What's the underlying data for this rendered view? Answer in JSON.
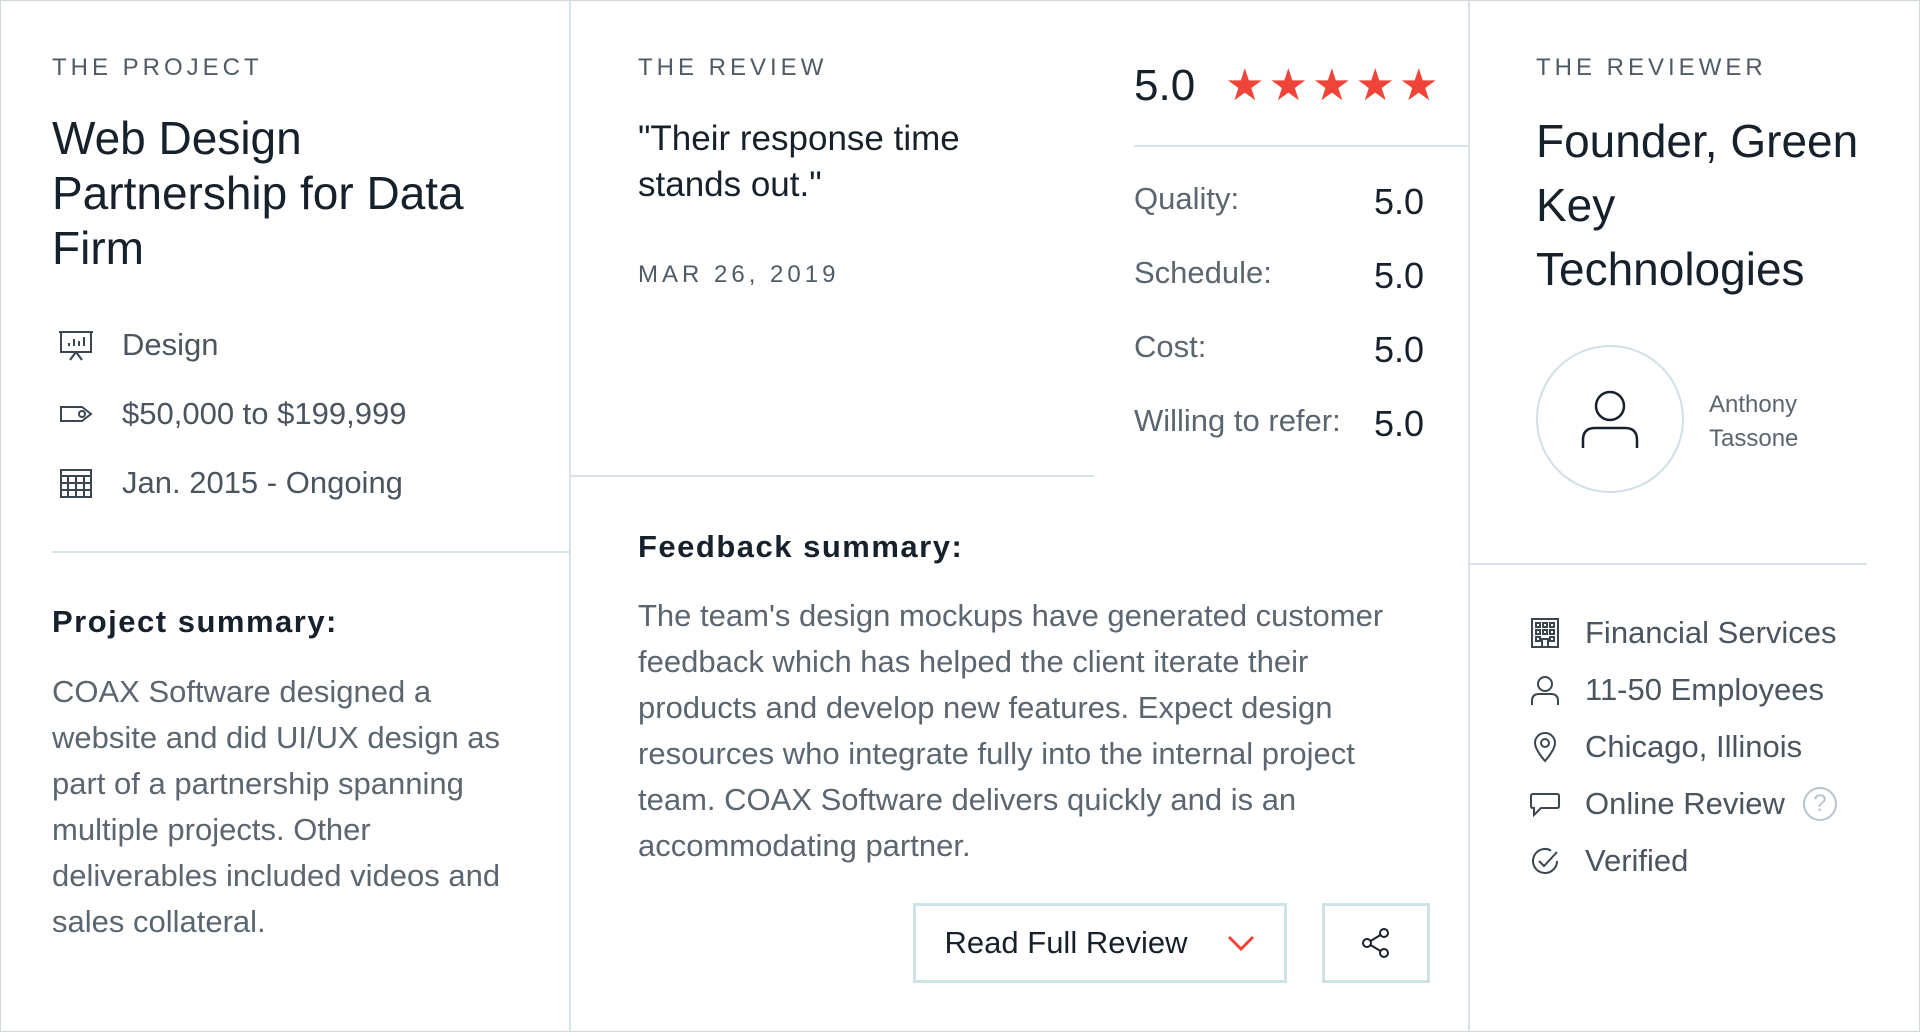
{
  "project": {
    "eyebrow": "THE PROJECT",
    "title": "Web Design Partnership for Data Firm",
    "service": "Design",
    "budget": "$50,000 to $199,999",
    "timeline": "Jan. 2015 - Ongoing",
    "summary_heading": "Project summary:",
    "summary_text": "COAX Software designed a website and did UI/UX design as part of a partnership spanning multiple projects. Other deliverables included videos and sales collateral."
  },
  "review": {
    "eyebrow": "THE REVIEW",
    "quote": "\"Their response time stands out.\"",
    "date": "MAR 26, 2019",
    "overall": "5.0",
    "stars": 5,
    "scores": [
      {
        "label": "Quality:",
        "value": "5.0"
      },
      {
        "label": "Schedule:",
        "value": "5.0"
      },
      {
        "label": "Cost:",
        "value": "5.0"
      },
      {
        "label": "Willing to refer:",
        "value": "5.0"
      }
    ],
    "feedback_heading": "Feedback summary:",
    "feedback_text": "The team's design mockups have generated customer feedback which has helped the client iterate their products and develop new features. Expect design resources who integrate fully into the internal project team. COAX Software delivers quickly and is an accommodating partner.",
    "read_full_label": "Read Full Review"
  },
  "reviewer": {
    "eyebrow": "THE REVIEWER",
    "title": "Founder, Green Key Technologies",
    "name": "Anthony Tassone",
    "industry": "Financial Services",
    "size": "11-50 Employees",
    "location": "Chicago, Illinois",
    "review_type": "Online Review",
    "help_glyph": "?",
    "verified": "Verified"
  },
  "colors": {
    "star": "#f04438",
    "divider": "#d6e4ea",
    "accent_chevron": "#f04438"
  }
}
